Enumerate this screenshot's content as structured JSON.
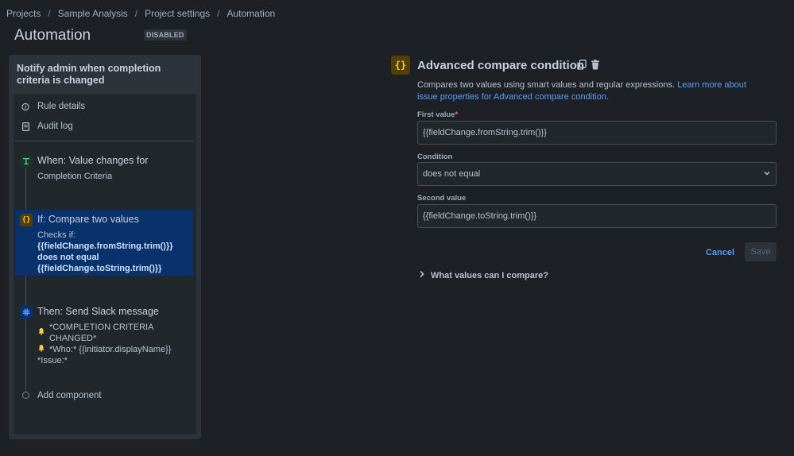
{
  "breadcrumb": [
    "Projects",
    "Sample Analysis",
    "Project settings",
    "Automation"
  ],
  "page": {
    "title": "Automation",
    "status": "DISABLED"
  },
  "rule": {
    "name": "Notify admin when completion criteria is changed",
    "menu": {
      "details": "Rule details",
      "audit": "Audit log"
    },
    "trigger": {
      "title": "When: Value changes for",
      "body": "Completion Criteria"
    },
    "condition": {
      "title": "If: Compare two values",
      "body_prefix": "Checks if:",
      "body_expr": "{{fieldChange.fromString.trim()}} does not equal {{fieldChange.toString.trim()}}"
    },
    "action": {
      "title": "Then: Send Slack message",
      "line1": "*COMPLETION CRITERIA CHANGED*",
      "line2": "*Who:* {{initiator.displayName}}",
      "line3": "*Issue:*"
    },
    "add_component": "Add component"
  },
  "config": {
    "title": "Advanced compare condition",
    "description": "Compares two values using smart values and regular expressions.",
    "learn_more": "Learn more about issue properties for Advanced compare condition.",
    "first_label": "First value",
    "first_value": "{{fieldChange.fromString.trim()}}",
    "condition_label": "Condition",
    "condition_value": "does not equal",
    "second_label": "Second value",
    "second_value": "{{fieldChange.toString.trim()}}",
    "cancel": "Cancel",
    "save": "Save",
    "expander": "What values can I compare?"
  },
  "colors": {
    "accent": "#579dff",
    "selected": "#09326c",
    "condition_icon": "#f5cd47"
  },
  "icons": [
    "info-icon",
    "audit-log-icon",
    "trigger-icon",
    "condition-icon",
    "slack-icon",
    "bell-icon",
    "copy-icon",
    "trash-icon",
    "chevron-down-icon",
    "chevron-right-icon"
  ]
}
